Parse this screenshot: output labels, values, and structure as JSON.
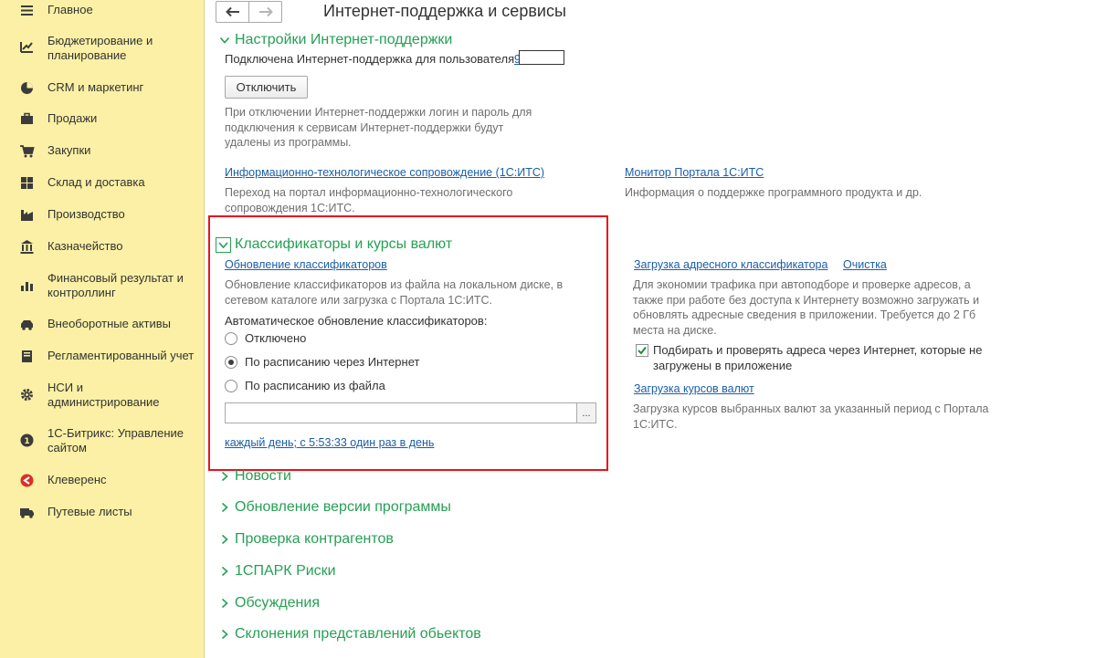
{
  "sidebar": {
    "items": [
      {
        "label": "Главное",
        "icon": "hamburger-icon"
      },
      {
        "label": "Бюджетирование и\nпланирование",
        "icon": "budget-chart-icon"
      },
      {
        "label": "CRM и маркетинг",
        "icon": "pie-chart-icon"
      },
      {
        "label": "Продажи",
        "icon": "briefcase-icon"
      },
      {
        "label": "Закупки",
        "icon": "shopping-cart-icon"
      },
      {
        "label": "Склад и доставка",
        "icon": "warehouse-grid-icon"
      },
      {
        "label": "Производство",
        "icon": "factory-icon"
      },
      {
        "label": "Казначейство",
        "icon": "treasury-icon"
      },
      {
        "label": "Финансовый результат и\nконтроллинг",
        "icon": "bar-chart-icon"
      },
      {
        "label": "Внеоборотные активы",
        "icon": "assets-car-icon"
      },
      {
        "label": "Регламентированный учет",
        "icon": "ledger-book-icon"
      },
      {
        "label": "НСИ и\nадминистрирование",
        "icon": "gear-icon"
      },
      {
        "label": "1С-Битрикс: Управление\nсайтом",
        "icon": "bitrix-icon"
      },
      {
        "label": "Клеверенс",
        "icon": "cleverence-icon"
      },
      {
        "label": "Путевые листы",
        "icon": "truck-icon"
      }
    ]
  },
  "header": {
    "back": "🡐",
    "forward": "🡒",
    "title": "Интернет-поддержка и сервисы"
  },
  "support": {
    "section_label": "Настройки Интернет-поддержки",
    "connected_text": "Подключена Интернет-поддержка для пользователя",
    "user_link": "9",
    "disconnect_button": "Отключить",
    "disconnect_hint": "При отключении Интернет-поддержки логин и пароль для\nподключения к сервисам Интернет-поддержки будут\nудалены из программы.",
    "its_link": "Информационно-технологическое сопровождение (1С:ИТС)",
    "its_hint": "Переход на портал информационно-технологического\nсопровождения 1С:ИТС.",
    "monitor_link": "Монитор Портала 1С:ИТС",
    "monitor_hint": "Информация о поддержке программного продукта и др."
  },
  "classifiers": {
    "section_label": "Классификаторы и курсы валют",
    "update_link": "Обновление классификаторов",
    "update_hint": "Обновление классификаторов из файла на локальном диске, в\nсетевом каталоге или загрузка с Портала 1С:ИТС.",
    "auto_label": "Автоматическое обновление классификаторов:",
    "options": [
      "Отключено",
      "По расписанию через Интернет",
      "По расписанию из файла"
    ],
    "selected_option": "По расписанию через Интернет",
    "file_path": "",
    "browse_button": "...",
    "schedule_link": "каждый день; с 5:53:33 один раз в день",
    "address_link": "Загрузка адресного классификатора",
    "clear_link": "Очистка",
    "address_hint": "Для экономии трафика при автоподборе и проверке адресов, а\nтакже при работе без доступа к Интернету возможно загружать и\nобновлять адресные сведения в приложении. Требуется до 2 Гб\nместа на диске.",
    "check_address_label": "Подбирать и проверять адреса через Интернет, которые не\nзагружены в приложение",
    "check_address_checked": true,
    "currency_link": "Загрузка курсов валют",
    "currency_hint": "Загрузка курсов выбранных валют за указанный период с Портала\n1С:ИТС."
  },
  "collapsed_sections": [
    "Новости",
    "Обновление версии программы",
    "Проверка контрагентов",
    "1СПАРК Риски",
    "Обсуждения",
    "Склонения представлений обьектов"
  ],
  "colors": {
    "sidebar_bg": "#fbf0a5",
    "section_green": "#25a054",
    "link_blue": "#1a5ea8",
    "highlight_red": "#e8141b"
  }
}
